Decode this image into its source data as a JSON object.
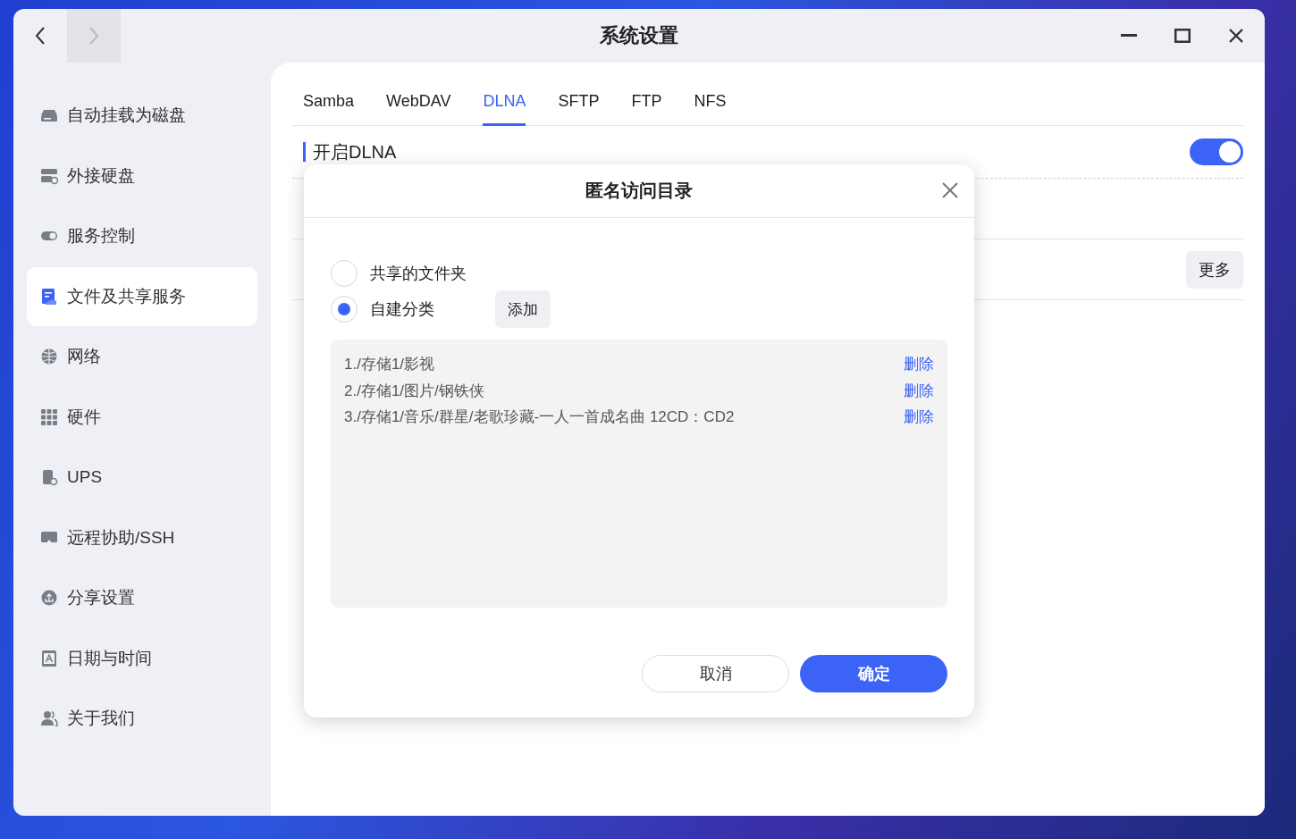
{
  "window": {
    "title": "系统设置",
    "back": {
      "disabled": false
    },
    "forward": {
      "disabled": true
    }
  },
  "sidebar": {
    "items": [
      {
        "label": "自动挂载为磁盘",
        "selected": false
      },
      {
        "label": "外接硬盘",
        "selected": false
      },
      {
        "label": "服务控制",
        "selected": false
      },
      {
        "label": "文件及共享服务",
        "selected": true
      },
      {
        "label": "网络",
        "selected": false
      },
      {
        "label": "硬件",
        "selected": false
      },
      {
        "label": "UPS",
        "selected": false
      },
      {
        "label": "远程协助/SSH",
        "selected": false
      },
      {
        "label": "分享设置",
        "selected": false
      },
      {
        "label": "日期与时间",
        "selected": false
      },
      {
        "label": "关于我们",
        "selected": false
      }
    ]
  },
  "tabs": [
    {
      "label": "Samba",
      "selected": false
    },
    {
      "label": "WebDAV",
      "selected": false
    },
    {
      "label": "DLNA",
      "selected": true
    },
    {
      "label": "SFTP",
      "selected": false
    },
    {
      "label": "FTP",
      "selected": false
    },
    {
      "label": "NFS",
      "selected": false
    }
  ],
  "setting": {
    "label": "开启DLNA",
    "on": true
  },
  "more_button": "更多",
  "dialog": {
    "title": "匿名访问目录",
    "options": [
      {
        "label": "共享的文件夹",
        "selected": false
      },
      {
        "label": "自建分类",
        "selected": true
      }
    ],
    "add_button": "添加",
    "entries": [
      {
        "path": "1./存储1/影视",
        "action": "删除"
      },
      {
        "path": "2./存储1/图片/钢铁侠",
        "action": "删除"
      },
      {
        "path": "3./存储1/音乐/群星/老歌珍藏-一人一首成名曲 12CD：CD2",
        "action": "删除"
      }
    ],
    "cancel": "取消",
    "confirm": "确定"
  }
}
